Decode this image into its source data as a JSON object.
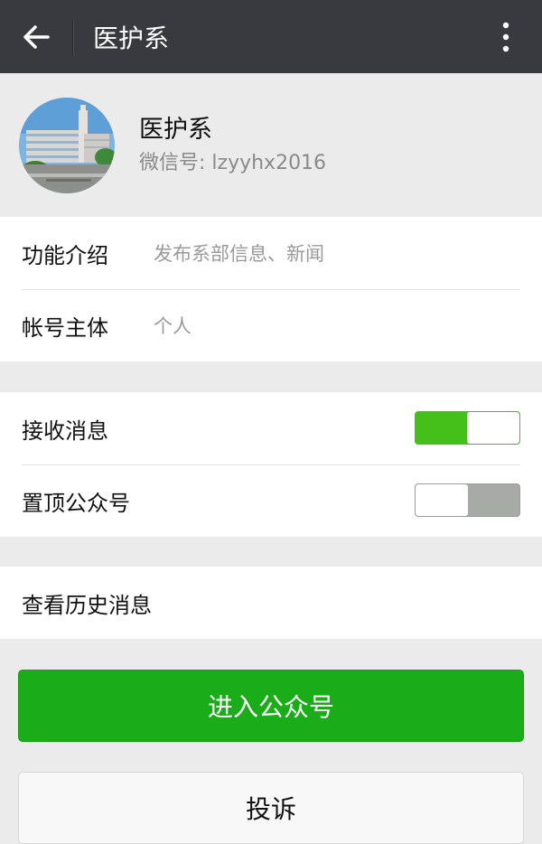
{
  "header": {
    "title": "医护系",
    "back_icon": "arrow-left-icon",
    "more_icon": "more-vertical-icon"
  },
  "profile": {
    "name": "医护系",
    "wechat_id": "微信号: lzyyhx2016"
  },
  "info": {
    "intro_label": "功能介绍",
    "intro_value": "发布系部信息、新闻",
    "owner_label": "帐号主体",
    "owner_value": "个人"
  },
  "settings": {
    "receive_label": "接收消息",
    "receive_on": true,
    "pin_label": "置顶公众号",
    "pin_on": false
  },
  "history": {
    "label": "查看历史消息"
  },
  "actions": {
    "enter_label": "进入公众号",
    "complain_label": "投诉"
  },
  "colors": {
    "topbar": "#393a3f",
    "accent_green": "#1aad19",
    "toggle_on": "#45c01a",
    "toggle_off": "#a8aaa8"
  }
}
